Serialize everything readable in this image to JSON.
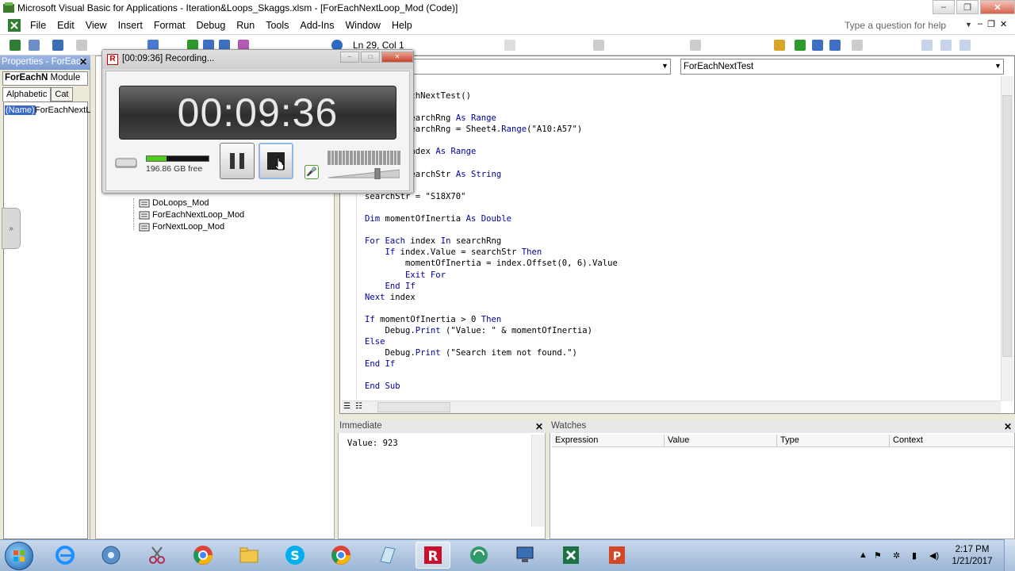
{
  "window": {
    "title": "Microsoft Visual Basic for Applications - Iteration&Loops_Skaggs.xlsm - [ForEachNextLoop_Mod (Code)]",
    "min_label": "–",
    "max_label": "❐",
    "close_label": "✕"
  },
  "menu": {
    "items": [
      "File",
      "Edit",
      "View",
      "Insert",
      "Format",
      "Debug",
      "Run",
      "Tools",
      "Add-Ins",
      "Window",
      "Help"
    ],
    "help_placeholder": "Type a question for help"
  },
  "toolbar": {
    "status": "Ln 29, Col 1"
  },
  "properties": {
    "title": "Properties - ForEach",
    "close": "✕",
    "object_name": "ForEachN",
    "object_type": "Module",
    "tabs": [
      "Alphabetic",
      "Cat"
    ],
    "row_name": "(Name)",
    "row_value": "ForEachNextL"
  },
  "project": {
    "tree": [
      "DoLoops_Mod",
      "ForEachNextLoop_Mod",
      "ForNextLoop_Mod"
    ]
  },
  "code": {
    "object_combo": "",
    "proc_combo": "ForEachNextTest",
    "lines": [
      "Sub ForEachNextTest()",
      "",
      "    Dim searchRng As Range",
      "    Set searchRng = Sheet4.Range(\"A10:A57\")",
      "",
      "    Dim index As Range",
      "",
      "    Dim searchStr As String",
      "",
      "searchStr = \"S18X70\"",
      "",
      "Dim momentOfInertia As Double",
      "",
      "For Each index In searchRng",
      "    If index.Value = searchStr Then",
      "        momentOfInertia = index.Offset(0, 6).Value",
      "        Exit For",
      "    End If",
      "Next index",
      "",
      "If momentOfInertia > 0 Then",
      "    Debug.Print (\"Value: \" & momentOfInertia)",
      "Else",
      "    Debug.Print (\"Search item not found.\")",
      "End If",
      "",
      "End Sub"
    ]
  },
  "immediate": {
    "title": "Immediate",
    "output": "Value: 923"
  },
  "watches": {
    "title": "Watches",
    "columns": [
      "Expression",
      "Value",
      "Type",
      "Context"
    ]
  },
  "recorder": {
    "title": "[00:09:36] Recording...",
    "time": "00:09:36",
    "disk_free": "196.86 GB free",
    "disk_used_fraction": 0.32,
    "volume_fraction": 0.7
  },
  "taskbar": {
    "time": "2:17 PM",
    "date": "1/21/2017",
    "apps": [
      "internet-explorer",
      "windows-media-center",
      "snipping-tool",
      "chrome",
      "file-explorer",
      "skype",
      "chrome-alt",
      "notepad",
      "recorder",
      "sync",
      "remote-desktop",
      "excel",
      "powerpoint"
    ]
  },
  "colors": {
    "keyword": "#0000a0",
    "selection": "#3a6ac8",
    "taskbar": "#9ab5d6"
  }
}
